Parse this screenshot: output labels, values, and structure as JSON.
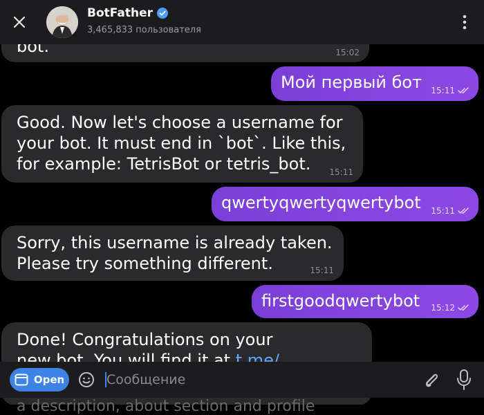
{
  "header": {
    "title": "BotFather",
    "subtitle": "3,465,833 пользователя"
  },
  "messages": [
    {
      "dir": "in",
      "lines": [
        "bot."
      ],
      "time": "15:02"
    },
    {
      "dir": "out",
      "text": "Мой первый бот",
      "time": "15:11"
    },
    {
      "dir": "in",
      "lines": [
        "Good. Now let's choose a username for",
        "your bot. It must end in `bot`. Like this,",
        "for example: TetrisBot or tetris_bot."
      ],
      "time": "15:11"
    },
    {
      "dir": "out",
      "text": "qwertyqwertyqwertybot",
      "time": "15:11"
    },
    {
      "dir": "in",
      "lines": [
        "Sorry, this username is already taken.",
        "Please try something different."
      ],
      "time": "15:11"
    },
    {
      "dir": "out",
      "text": "firstgoodqwertybot",
      "time": "15:12"
    },
    {
      "dir": "in",
      "line1": "Done! Congratulations on your",
      "line2_text": "new bot. You will find it at ",
      "line2_link": "t.me/"
    }
  ],
  "composer": {
    "open_label": "Open",
    "placeholder": "Сообщение"
  },
  "below_text": "a description, about section and profile"
}
